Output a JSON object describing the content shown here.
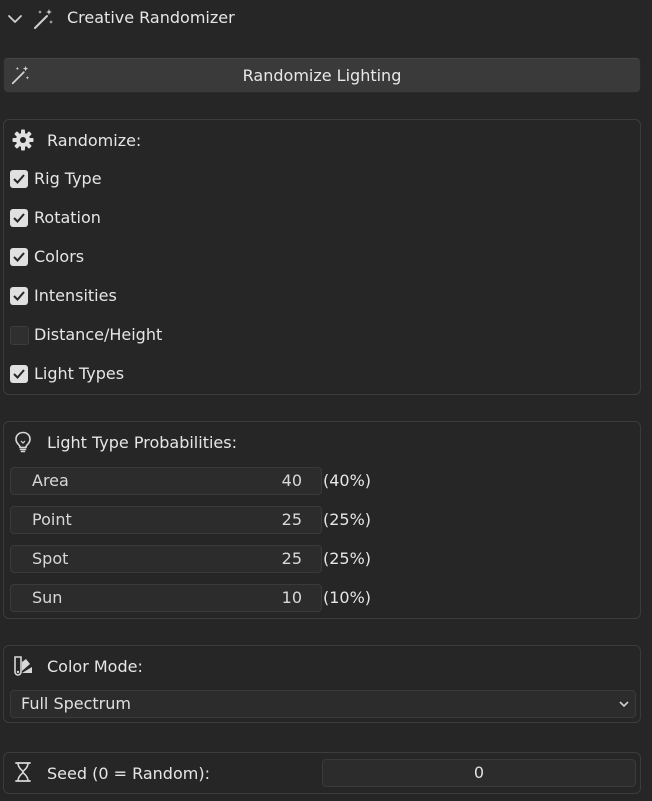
{
  "header": {
    "title": "Creative Randomizer"
  },
  "action": {
    "label": "Randomize Lighting"
  },
  "randomize": {
    "title": "Randomize:",
    "options": [
      {
        "label": "Rig Type",
        "checked": true
      },
      {
        "label": "Rotation",
        "checked": true
      },
      {
        "label": "Colors",
        "checked": true
      },
      {
        "label": "Intensities",
        "checked": true
      },
      {
        "label": "Distance/Height",
        "checked": false
      },
      {
        "label": "Light Types",
        "checked": true
      }
    ]
  },
  "probabilities": {
    "title": "Light Type Probabilities:",
    "rows": [
      {
        "name": "Area",
        "value": "40",
        "percent": "(40%)"
      },
      {
        "name": "Point",
        "value": "25",
        "percent": "(25%)"
      },
      {
        "name": "Spot",
        "value": "25",
        "percent": "(25%)"
      },
      {
        "name": "Sun",
        "value": "10",
        "percent": "(10%)"
      }
    ]
  },
  "color_mode": {
    "title": "Color Mode:",
    "selected": "Full Spectrum"
  },
  "seed": {
    "label": "Seed (0 = Random):",
    "value": "0"
  },
  "colors": {
    "panel_bg": "#262626",
    "button_bg": "#3a3a3a",
    "checkbox_on": "#e0e0e0",
    "text": "#e6e6e6"
  }
}
